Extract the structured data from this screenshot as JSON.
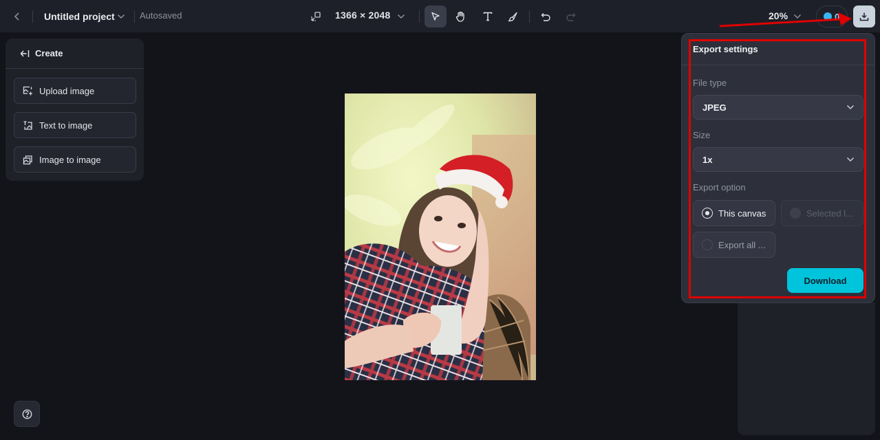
{
  "topbar": {
    "back_icon": "chevron-left-icon",
    "project_title": "Untitled project",
    "project_menu_icon": "chevron-down-icon",
    "save_status": "Autosaved",
    "resize_icon": "resize-icon",
    "canvas_size": "1366 × 2048",
    "canvas_size_icon": "chevron-down-icon",
    "tools": [
      {
        "name": "select",
        "icon": "pointer-icon",
        "active": true
      },
      {
        "name": "hand",
        "icon": "hand-icon",
        "active": false
      },
      {
        "name": "text",
        "icon": "text-icon",
        "active": false
      },
      {
        "name": "brush",
        "icon": "brush-icon",
        "active": false
      }
    ],
    "undo_icon": "undo-icon",
    "redo_icon": "redo-icon",
    "zoom_level": "20%",
    "credits": "0",
    "export_icon": "download-icon"
  },
  "left_panel": {
    "header": "Create",
    "items": [
      {
        "label": "Upload image",
        "icon": "upload-image-icon"
      },
      {
        "label": "Text to image",
        "icon": "text-to-image-icon"
      },
      {
        "label": "Image to image",
        "icon": "image-to-image-icon"
      }
    ]
  },
  "help_icon": "help-icon",
  "canvas": {
    "description": "Smiling woman in Santa hat and plaid shirt holding a mug"
  },
  "export_settings": {
    "title": "Export settings",
    "file_type_label": "File type",
    "file_type_value": "JPEG",
    "size_label": "Size",
    "size_value": "1x",
    "export_option_label": "Export option",
    "options": [
      {
        "label": "This canvas",
        "selected": true,
        "disabled": false
      },
      {
        "label": "Selected l...",
        "selected": false,
        "disabled": true
      },
      {
        "label": "Export all ...",
        "selected": false,
        "disabled": false
      }
    ],
    "download_label": "Download",
    "accent_color": "#00c4dc"
  },
  "annotation": {
    "color": "#e00000"
  }
}
